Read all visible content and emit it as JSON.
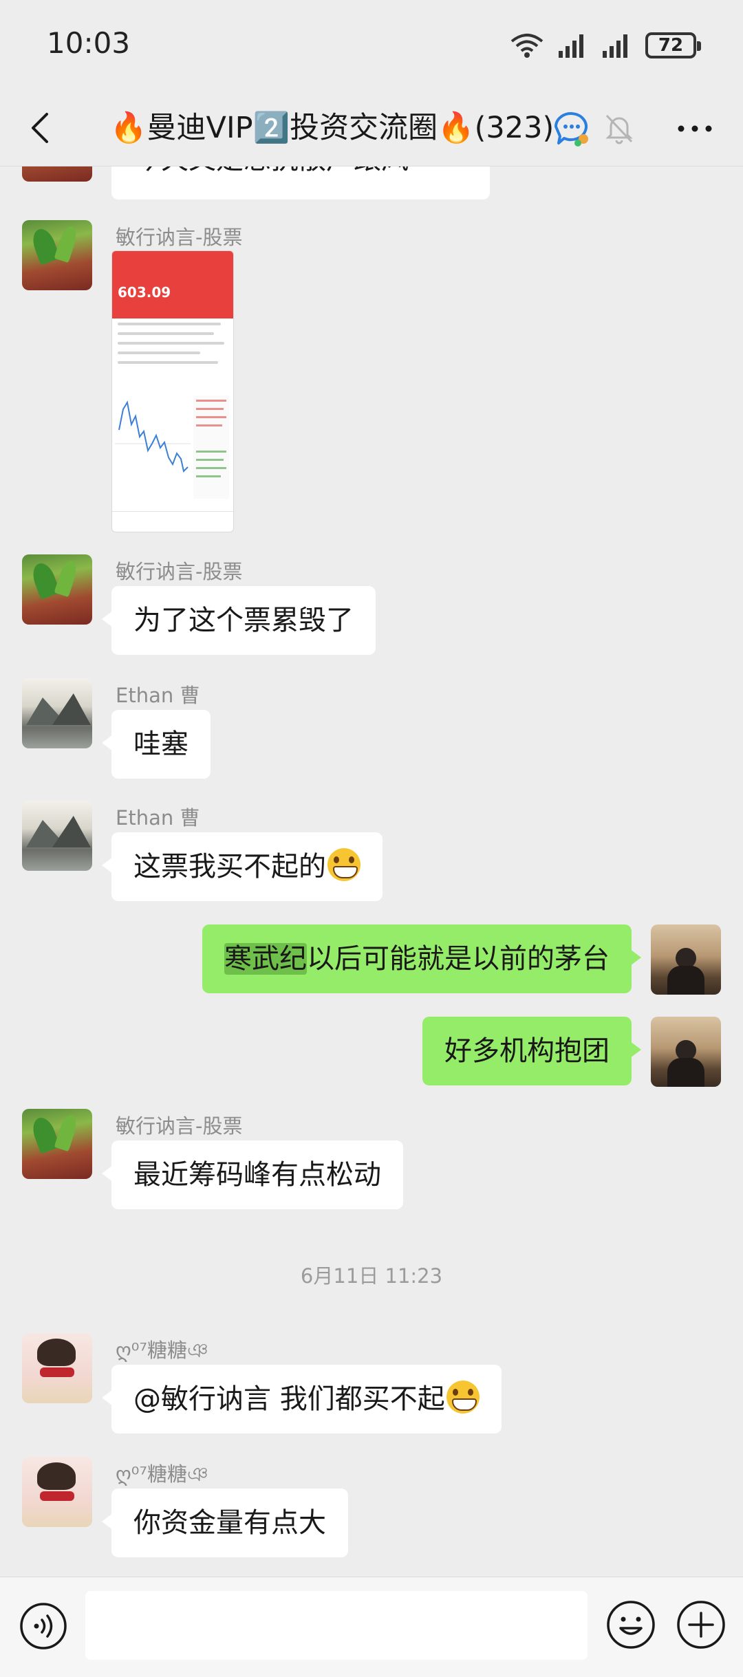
{
  "status_bar": {
    "time": "10:03",
    "battery": "72"
  },
  "nav": {
    "title": "🔥曼迪VIP2️⃣投资交流圈🔥(323)"
  },
  "messages": [
    {
      "id": "m0",
      "side": "left",
      "text": "今天又是想抗散户跟风"
    },
    {
      "id": "m1",
      "side": "left",
      "sender": "敏行讷言-股票",
      "type": "image",
      "image_price": "603.09"
    },
    {
      "id": "m2",
      "side": "left",
      "sender": "敏行讷言-股票",
      "text": "为了这个票累毁了"
    },
    {
      "id": "m3",
      "side": "left",
      "sender": "Ethan 曹",
      "text": "哇塞"
    },
    {
      "id": "m4",
      "side": "left",
      "sender": "Ethan 曹",
      "text": "这票我买不起的"
    },
    {
      "id": "m5",
      "side": "right",
      "highlight": "寒武纪",
      "text": "以后可能就是以前的茅台"
    },
    {
      "id": "m6",
      "side": "right",
      "text": "好多机构抱团"
    },
    {
      "id": "m7",
      "side": "left",
      "sender": "敏行讷言-股票",
      "text": "最近筹码峰有点松动"
    },
    {
      "id": "m8",
      "side": "left",
      "sender": "ღ⁰⁷糖糖ঞ",
      "text": "@敏行讷言  我们都买不起"
    },
    {
      "id": "m9",
      "side": "left",
      "sender": "ღ⁰⁷糖糖ঞ",
      "text": "你资金量有点大"
    }
  ],
  "timestamp": "6月11日 11:23",
  "input_bar": {
    "placeholder": ""
  },
  "colors": {
    "background": "#ededed",
    "bubble_self": "#95ec69",
    "bubble_other": "#ffffff",
    "stock_header": "#e8403c"
  }
}
